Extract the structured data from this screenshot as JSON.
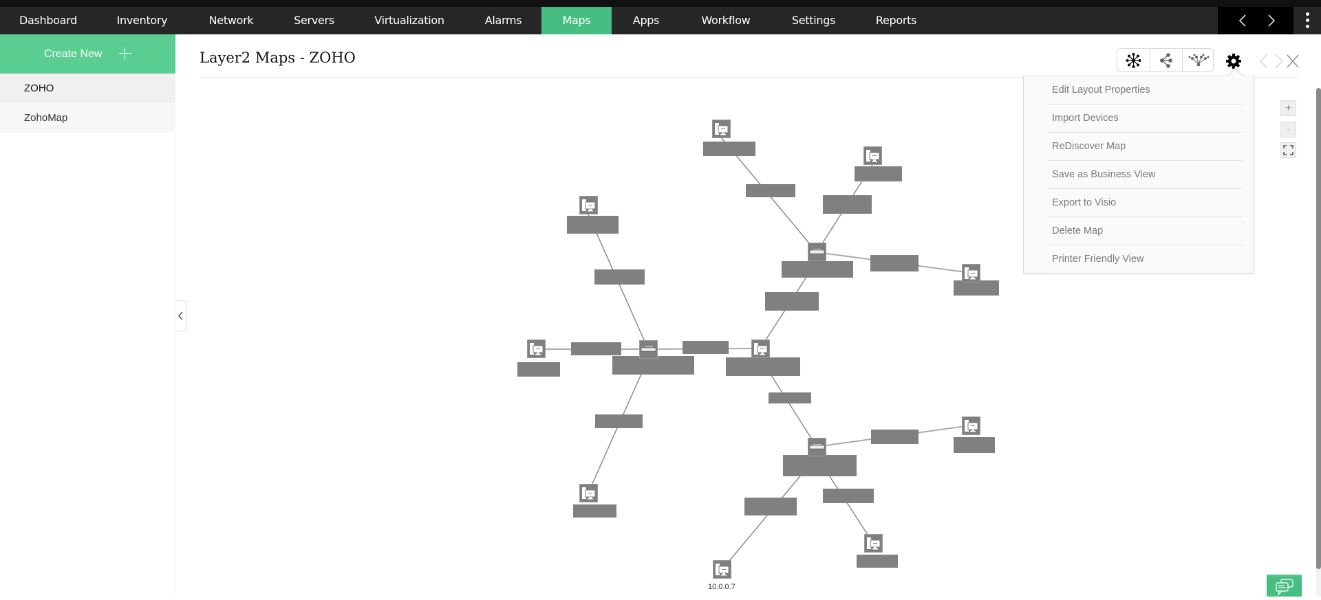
{
  "nav": {
    "items": [
      {
        "label": "Dashboard",
        "active": false
      },
      {
        "label": "Inventory",
        "active": false
      },
      {
        "label": "Network",
        "active": false
      },
      {
        "label": "Servers",
        "active": false
      },
      {
        "label": "Virtualization",
        "active": false
      },
      {
        "label": "Alarms",
        "active": false
      },
      {
        "label": "Maps",
        "active": true
      },
      {
        "label": "Apps",
        "active": false
      },
      {
        "label": "Workflow",
        "active": false
      },
      {
        "label": "Settings",
        "active": false
      },
      {
        "label": "Reports",
        "active": false
      }
    ],
    "active_color": "#47bd82"
  },
  "sidebar": {
    "create_new_label": "Create New",
    "items": [
      {
        "label": "ZOHO",
        "selected": true
      },
      {
        "label": "ZohoMap",
        "selected": false
      }
    ]
  },
  "main": {
    "title": "Layer2 Maps - ZOHO",
    "layout_buttons": [
      "star-layout-icon",
      "tree-layout-icon",
      "hierarchy-layout-icon"
    ],
    "settings_menu": [
      "Edit Layout Properties",
      "Import Devices",
      "ReDiscover Map",
      "Save as Business View",
      "Export to Visio",
      "Delete Map",
      "Printer Friendly View"
    ],
    "zoom_controls": {
      "zoom_in": "+",
      "zoom_out": "-"
    }
  },
  "map": {
    "visible_device_label": "10.0.0.7",
    "node_types": {
      "switch": "switch-icon",
      "workstation": "workstation-icon"
    },
    "redacted_label_color": "#808080"
  },
  "colors": {
    "nav_bg": "#262626",
    "sidebar_green": "#5ace91",
    "chat_green": "#47bd82"
  }
}
